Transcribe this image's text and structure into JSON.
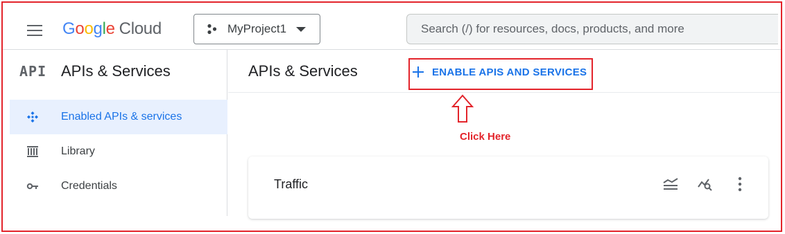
{
  "header": {
    "logo_word": [
      "G",
      "o",
      "o",
      "g",
      "l",
      "e"
    ],
    "logo_suffix": "Cloud",
    "project_name": "MyProject1",
    "search_placeholder": "Search (/) for resources, docs, products, and more"
  },
  "sidebar": {
    "glyph": "API",
    "title": "APIs & Services",
    "items": [
      {
        "label": "Enabled APIs & services",
        "icon": "enabled-apis-icon",
        "active": true
      },
      {
        "label": "Library",
        "icon": "library-icon",
        "active": false
      },
      {
        "label": "Credentials",
        "icon": "key-icon",
        "active": false
      }
    ]
  },
  "main": {
    "title": "APIs & Services",
    "enable_button_label": "ENABLE APIS AND SERVICES",
    "annotation": "Click Here",
    "card_title": "Traffic"
  },
  "colors": {
    "accent": "#1a73e8",
    "annotation_red": "#e3242b",
    "active_bg": "#e8f0fe"
  }
}
